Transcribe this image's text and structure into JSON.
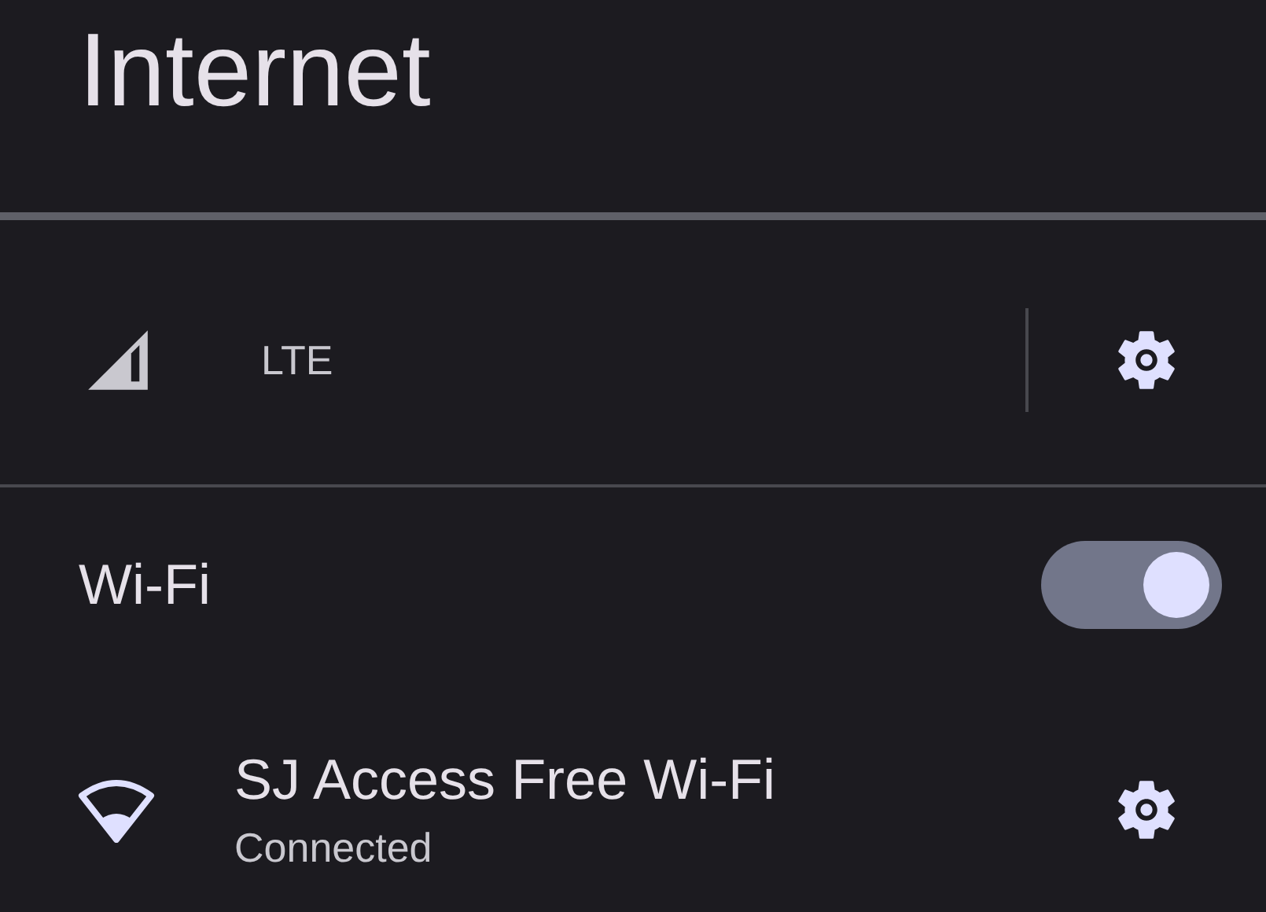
{
  "title": "Internet",
  "mobile": {
    "label": "LTE"
  },
  "wifi": {
    "label": "Wi-Fi",
    "on": true
  },
  "networks": [
    {
      "name": "SJ Access Free Wi-Fi",
      "status": "Connected"
    }
  ]
}
